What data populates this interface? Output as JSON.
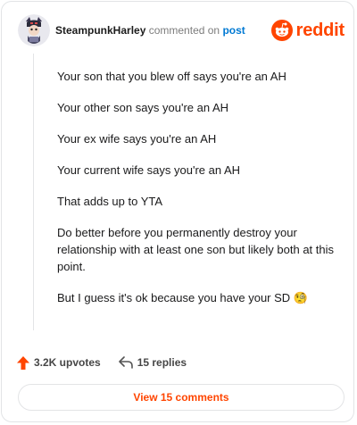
{
  "header": {
    "username": "SteampunkHarley",
    "action_text": "commented on",
    "post_link": "post",
    "brand_name": "reddit"
  },
  "comment": {
    "paragraphs": [
      "Your son that you blew off says you're an AH",
      "Your other son says you're an AH",
      "Your ex wife says you're an AH",
      "Your current wife says you're an AH",
      "That adds up to YTA",
      "Do better before you permanently destroy your relationship with at least one son but likely both at this point.",
      "But I guess it's ok because you have your SD 🧐"
    ]
  },
  "footer": {
    "upvotes": "3.2K upvotes",
    "replies": "15 replies",
    "view_comments": "View 15 comments"
  },
  "colors": {
    "brand": "#ff4500",
    "link": "#0079d3",
    "upvote": "#ff4500"
  },
  "icons": [
    "avatar",
    "reddit-logo-icon",
    "upvote-arrow-icon",
    "reply-arrow-icon"
  ]
}
